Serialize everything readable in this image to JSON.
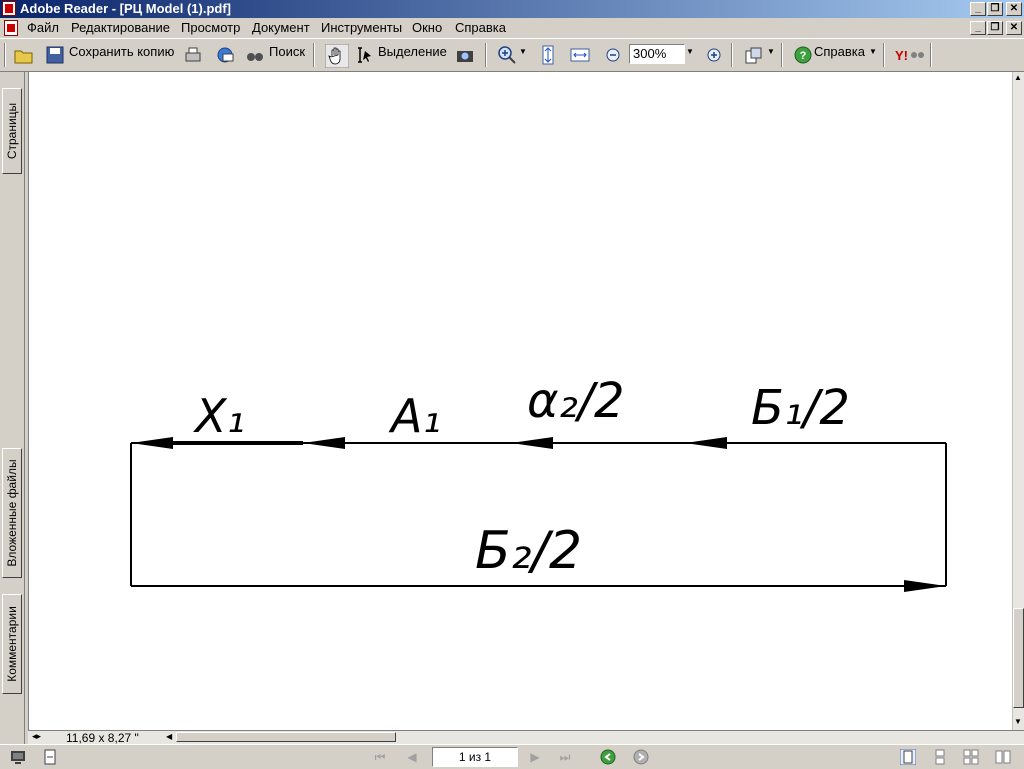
{
  "window": {
    "title": "Adobe Reader - [РЦ Model (1).pdf]"
  },
  "menu": [
    "Файл",
    "Редактирование",
    "Просмотр",
    "Документ",
    "Инструменты",
    "Окно",
    "Справка"
  ],
  "toolbar": {
    "save_copy": "Сохранить копию",
    "search": "Поиск",
    "select": "Выделение",
    "zoom": "300%",
    "help": "Справка"
  },
  "sidebar": {
    "tabs": [
      "Страницы",
      "Вложенные файлы",
      "Комментарии"
    ]
  },
  "diagram": {
    "labels": [
      "X₁",
      "A₁",
      "α₂/2",
      "Б₁/2",
      "Б₂/2"
    ]
  },
  "status": {
    "page_size": "11,69 x 8,27 \"",
    "page": "1 из 1"
  },
  "colors": {
    "title_start": "#0a246a",
    "title_end": "#a6caf0",
    "chrome": "#d4d0c8"
  }
}
